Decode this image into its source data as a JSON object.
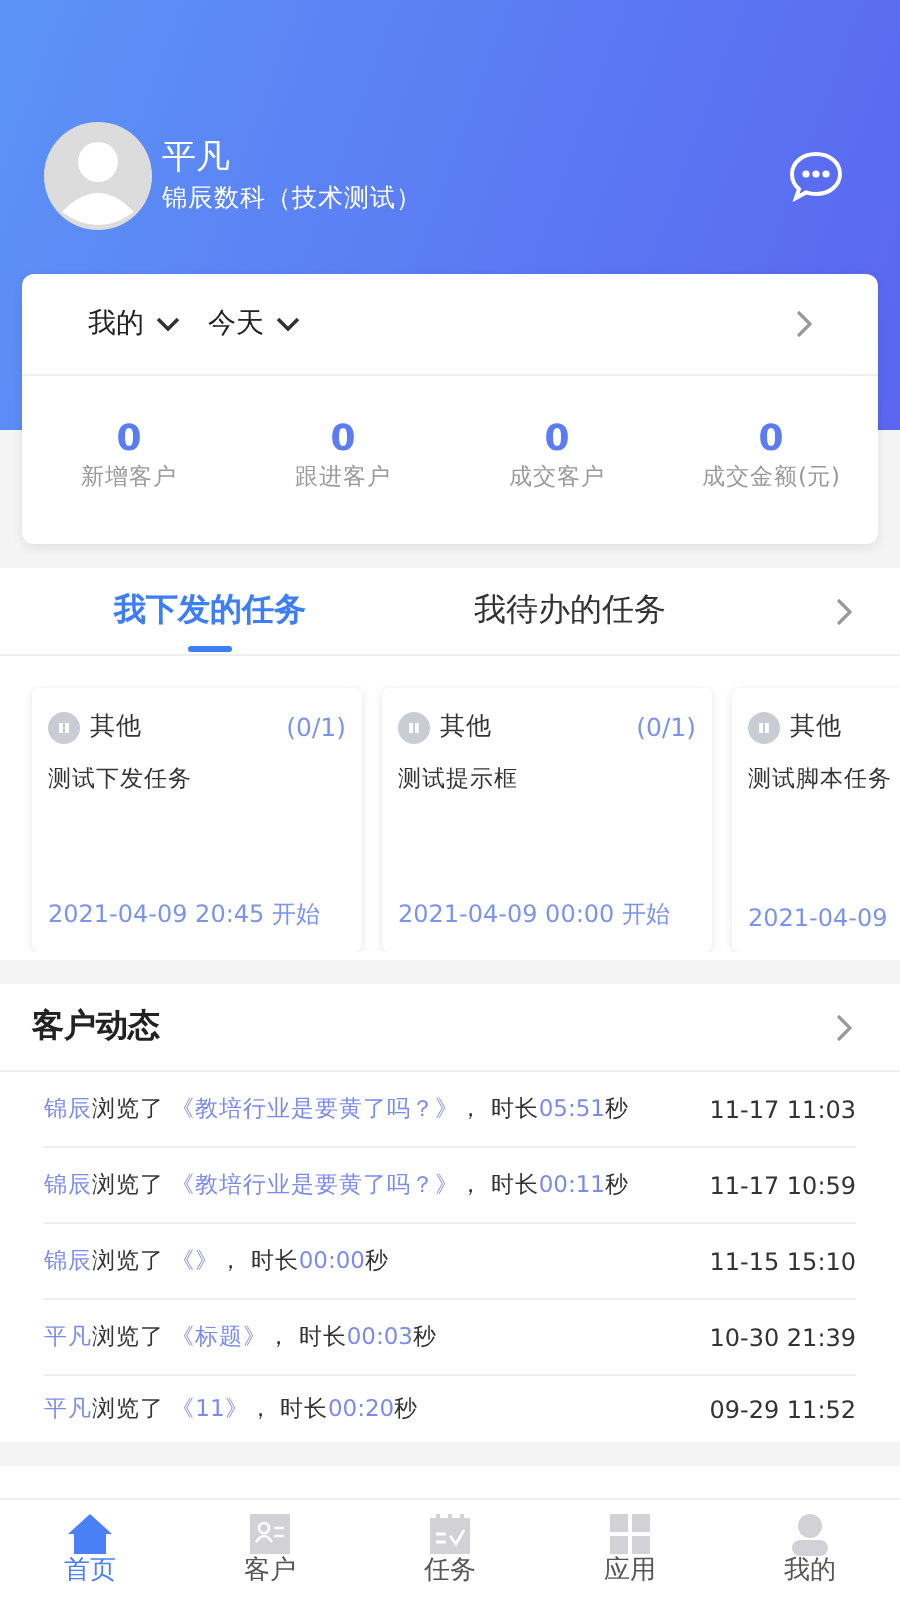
{
  "profile": {
    "name": "平凡",
    "company": "锦辰数科（技术测试）"
  },
  "summary": {
    "filters": [
      {
        "label": "我的"
      },
      {
        "label": "今天"
      }
    ],
    "stats": [
      {
        "value": "0",
        "label": "新增客户"
      },
      {
        "value": "0",
        "label": "跟进客户"
      },
      {
        "value": "0",
        "label": "成交客户"
      },
      {
        "value": "0",
        "label": "成交金额(元)"
      }
    ]
  },
  "task_tabs": [
    {
      "label": "我下发的任务",
      "selected": true
    },
    {
      "label": "我待办的任务",
      "selected": false
    }
  ],
  "tasks": [
    {
      "category": "其他",
      "count": "(0/1)",
      "title": "测试下发任务",
      "date": "2021-04-09 20:45 开始"
    },
    {
      "category": "其他",
      "count": "(0/1)",
      "title": "测试提示框",
      "date": "2021-04-09 00:00 开始"
    },
    {
      "category": "其他",
      "title": "测试脚本任务",
      "date": "2021-04-09"
    }
  ],
  "activity": {
    "title": "客户动态",
    "rows": [
      {
        "actor": "锦辰",
        "verb": "浏览了",
        "item": "《教培行业是要黄了吗？》",
        "sep": "，",
        "duration_label": "时长",
        "duration": "05:51",
        "unit": "秒",
        "time": "11-17 11:03"
      },
      {
        "actor": "锦辰",
        "verb": "浏览了",
        "item": "《教培行业是要黄了吗？》",
        "sep": "，",
        "duration_label": "时长",
        "duration": "00:11",
        "unit": "秒",
        "time": "11-17 10:59"
      },
      {
        "actor": "锦辰",
        "verb": "浏览了",
        "item": "《》",
        "sep": "，",
        "duration_label": "时长",
        "duration": "00:00",
        "unit": "秒",
        "time": "11-15 15:10"
      },
      {
        "actor": "平凡",
        "verb": "浏览了",
        "item": "《标题》",
        "sep": "，",
        "duration_label": "时长",
        "duration": "00:03",
        "unit": "秒",
        "time": "10-30 21:39"
      },
      {
        "actor": "平凡",
        "verb": "浏览了",
        "item": "《11》",
        "sep": "，",
        "duration_label": "时长",
        "duration": "00:20",
        "unit": "秒",
        "time": "09-29 11:52"
      }
    ]
  },
  "tab_bar": [
    {
      "kind": "home",
      "label": "首页",
      "selected": true
    },
    {
      "kind": "contacts",
      "label": "客户",
      "selected": false
    },
    {
      "kind": "tasks",
      "label": "任务",
      "selected": false
    },
    {
      "kind": "apps",
      "label": "应用",
      "selected": false
    },
    {
      "kind": "me",
      "label": "我的",
      "selected": false
    }
  ]
}
